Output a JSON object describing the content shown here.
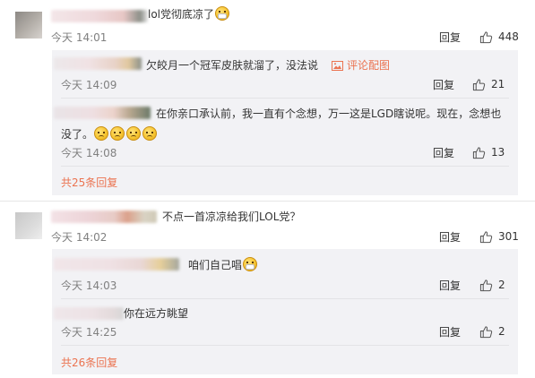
{
  "labels": {
    "reply": "回复",
    "report_image": "评论配图"
  },
  "comments": [
    {
      "text": "lol党彻底凉了",
      "time": "今天 14:01",
      "likes": "448",
      "replies": [
        {
          "text": "欠皎月一个冠军皮肤就溜了，没法说",
          "time": "今天 14:09",
          "likes": "21"
        },
        {
          "text_line1": "在你亲口承认前，我一直有个念想，万一这是LGD瞎说呢。现在，念想也",
          "text_line2": "没了。",
          "time": "今天 14:08",
          "likes": "13"
        }
      ],
      "more_replies": "共25条回复"
    },
    {
      "text": "不点一首凉凉给我们LOL党？",
      "time": "今天 14:02",
      "likes": "301",
      "replies": [
        {
          "text": "咱们自己唱",
          "time": "今天 14:03",
          "likes": "2"
        },
        {
          "text": "你在远方眺望",
          "time": "今天 14:25",
          "likes": "2"
        }
      ],
      "more_replies": "共26条回复"
    }
  ],
  "colors": {
    "accent": "#eb7350",
    "muted": "#808080",
    "reply_bg": "#f2f2f5"
  },
  "icons": [
    "thumbs-up-icon",
    "image-icon",
    "sad-face-emoji",
    "mask-face-emoji"
  ]
}
